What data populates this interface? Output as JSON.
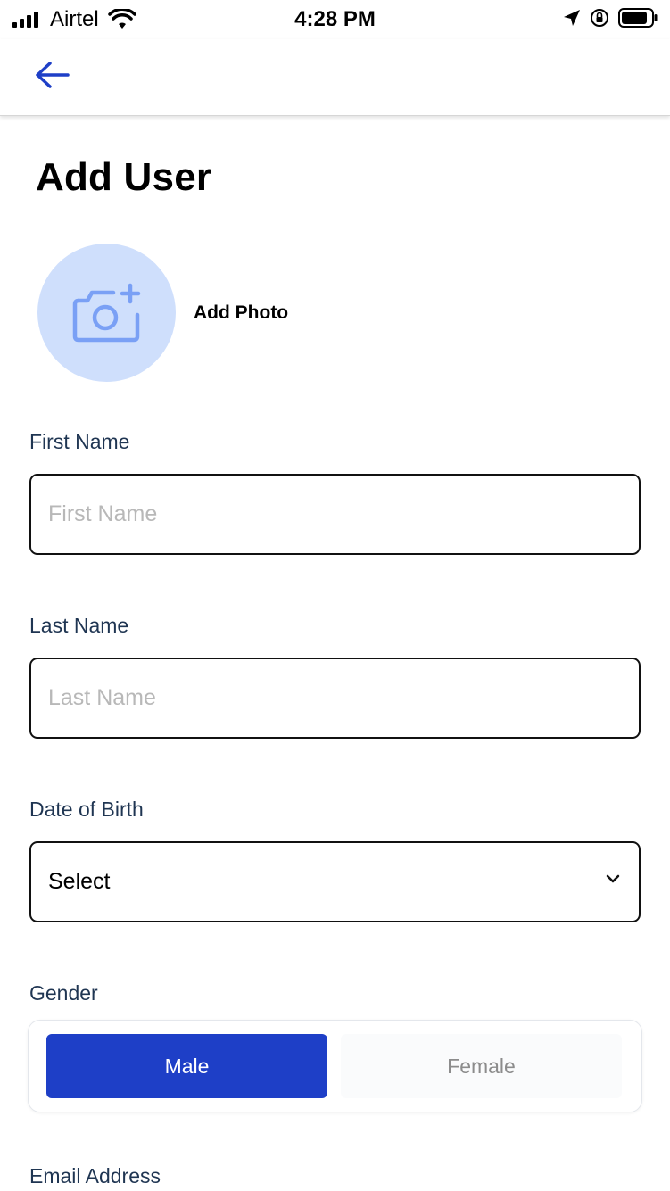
{
  "status_bar": {
    "carrier": "Airtel",
    "time": "4:28 PM"
  },
  "header": {
    "back_icon": "arrow-left-icon"
  },
  "page": {
    "title": "Add User"
  },
  "photo": {
    "label": "Add Photo",
    "icon": "camera-plus-icon"
  },
  "form": {
    "first_name": {
      "label": "First Name",
      "placeholder": "First Name",
      "value": ""
    },
    "last_name": {
      "label": "Last Name",
      "placeholder": "Last Name",
      "value": ""
    },
    "dob": {
      "label": "Date of Birth",
      "value": "Select"
    },
    "gender": {
      "label": "Gender",
      "options": [
        "Male",
        "Female"
      ],
      "selected": "Male"
    },
    "email": {
      "label": "Email Address"
    }
  },
  "colors": {
    "accent": "#1e3fc7",
    "photo_bg": "#cfdffc",
    "label_text": "#1f3552"
  }
}
